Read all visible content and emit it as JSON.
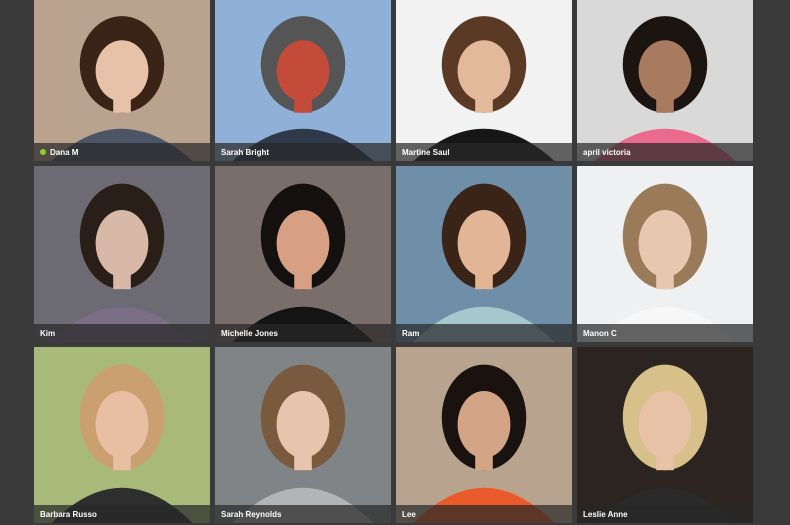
{
  "profiles": [
    {
      "name": "Dana M",
      "online": true,
      "bg": "#b9a38f",
      "hair": "#3a2418",
      "skin": "#e8c2a8",
      "shirt": "#4b5566"
    },
    {
      "name": "Sarah Bright",
      "online": false,
      "bg": "#8fb1d8",
      "hair": "#555555",
      "skin": "#c44a3a",
      "shirt": "#2e3a4a"
    },
    {
      "name": "Martine Saul",
      "online": false,
      "bg": "#f2f2f2",
      "hair": "#5a3a24",
      "skin": "#e3b99c",
      "shirt": "#161616"
    },
    {
      "name": "april victoria",
      "online": false,
      "bg": "#d9d9d9",
      "hair": "#1c1410",
      "skin": "#a87a60",
      "shirt": "#ea6a8f"
    },
    {
      "name": "Kim",
      "online": false,
      "bg": "#6c6a72",
      "hair": "#2a1e18",
      "skin": "#d8b8a6",
      "shirt": "#7a6e84"
    },
    {
      "name": "Michelle Jones",
      "online": false,
      "bg": "#7a6e6a",
      "hair": "#151010",
      "skin": "#d79f84",
      "shirt": "#141414"
    },
    {
      "name": "Ram",
      "online": false,
      "bg": "#6f8fa8",
      "hair": "#3a2418",
      "skin": "#e2b596",
      "shirt": "#a7c7cf"
    },
    {
      "name": "Manon C",
      "online": false,
      "bg": "#eef0f2",
      "hair": "#9a7a58",
      "skin": "#e8c7b0",
      "shirt": "#f7f7f7"
    },
    {
      "name": "Barbara Russo",
      "online": false,
      "bg": "#a9b97a",
      "hair": "#caa070",
      "skin": "#e8bfa2",
      "shirt": "#2e2e2e"
    },
    {
      "name": "Sarah Reynolds",
      "online": false,
      "bg": "#808486",
      "hair": "#7a5a3e",
      "skin": "#e7c4ae",
      "shirt": "#b2b4b6"
    },
    {
      "name": "Lee",
      "online": false,
      "bg": "#b8a48e",
      "hair": "#1a120e",
      "skin": "#d3a486",
      "shirt": "#ea5a2a"
    },
    {
      "name": "Leslie Anne",
      "online": false,
      "bg": "#2c2420",
      "hair": "#d7c08a",
      "skin": "#e8c2a6",
      "shirt": "#2a2a2a"
    }
  ]
}
